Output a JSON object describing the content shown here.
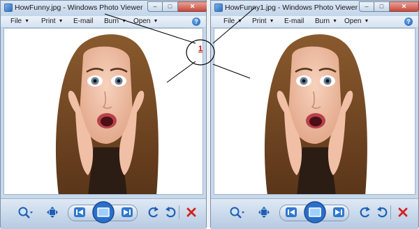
{
  "windows": [
    {
      "title": "HowFunny.jpg - Windows Photo Viewer",
      "menu": [
        {
          "label": "File"
        },
        {
          "label": "Print"
        },
        {
          "label": "E-mail"
        },
        {
          "label": "Burn"
        },
        {
          "label": "Open"
        }
      ],
      "caption": {
        "minimize": "–",
        "maximize": "□",
        "close": "✕"
      },
      "help": "?"
    },
    {
      "title": "HowFunny1.jpg - Windows Photo Viewer",
      "menu": [
        {
          "label": "File"
        },
        {
          "label": "Print"
        },
        {
          "label": "E-mail"
        },
        {
          "label": "Burn"
        },
        {
          "label": "Open"
        }
      ],
      "caption": {
        "minimize": "–",
        "maximize": "□",
        "close": "✕"
      },
      "help": "?"
    }
  ],
  "annotation": {
    "label": "1",
    "color": "#cc0000"
  },
  "icons": [
    "zoom-icon",
    "actual-size-icon",
    "previous-icon",
    "slideshow-icon",
    "next-icon",
    "rotate-left-icon",
    "rotate-right-icon",
    "delete-icon"
  ],
  "colors": {
    "accent": "#1d5fb3",
    "delete": "#d42020",
    "title_bg": "#c9d9ec"
  }
}
